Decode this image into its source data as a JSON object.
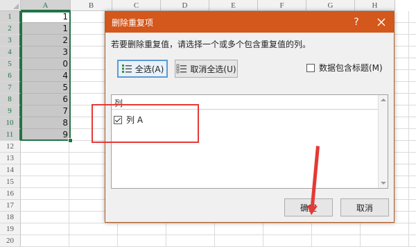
{
  "spreadsheet": {
    "columns": [
      "A",
      "B",
      "C",
      "D",
      "E",
      "F",
      "G",
      "H"
    ],
    "rows": [
      "1",
      "2",
      "3",
      "4",
      "5",
      "6",
      "7",
      "8",
      "9",
      "10",
      "11",
      "12",
      "13",
      "14",
      "15",
      "16",
      "17",
      "18",
      "19",
      "20"
    ],
    "column_a_values": [
      "1",
      "1",
      "2",
      "3",
      "0",
      "4",
      "5",
      "6",
      "7",
      "8",
      "9"
    ],
    "selected_column": "A",
    "accent_color": "#217346"
  },
  "dialog": {
    "title": "删除重复项",
    "help_label": "?",
    "instruction": "若要删除重复值，请选择一个或多个包含重复值的列。",
    "select_all_label": "全选(A)",
    "unselect_all_label": "取消全选(U)",
    "header_checkbox_label": "数据包含标题(M)",
    "header_checkbox_checked": false,
    "list_header": "列",
    "columns_list": [
      {
        "label": "列 A",
        "checked": true
      }
    ],
    "ok_label": "确定",
    "cancel_label": "取消",
    "title_color": "#d4571b"
  },
  "annotations": {
    "highlight_color": "#e53935"
  }
}
